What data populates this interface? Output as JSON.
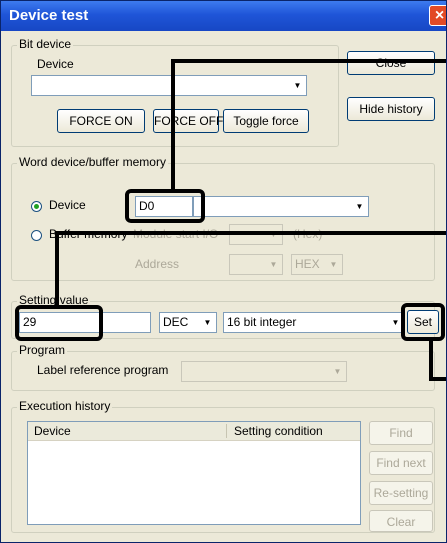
{
  "window": {
    "title": "Device test"
  },
  "bit_device": {
    "legend": "Bit device",
    "device_label": "Device",
    "device_value": "",
    "force_on": "FORCE ON",
    "force_off": "FORCE OFF",
    "toggle_force": "Toggle force"
  },
  "side_buttons": {
    "close": "Close",
    "hide_history": "Hide history"
  },
  "word_device": {
    "legend": "Word device/buffer memory",
    "radio_device": "Device",
    "device_value": "D0",
    "radio_buffer": "Buffer memory",
    "module_start_label": "Module start I/O",
    "hex_label": "(Hex)",
    "address_label": "Address",
    "address_format": "HEX"
  },
  "setting": {
    "legend": "Setting value",
    "value": "29",
    "base": "DEC",
    "type": "16 bit integer",
    "set_button": "Set"
  },
  "program": {
    "legend": "Program",
    "label_ref": "Label reference program",
    "value": ""
  },
  "history": {
    "legend": "Execution history",
    "columns": [
      "Device",
      "Setting condition"
    ],
    "find": "Find",
    "find_next": "Find next",
    "resetting": "Re-setting",
    "clear": "Clear"
  }
}
